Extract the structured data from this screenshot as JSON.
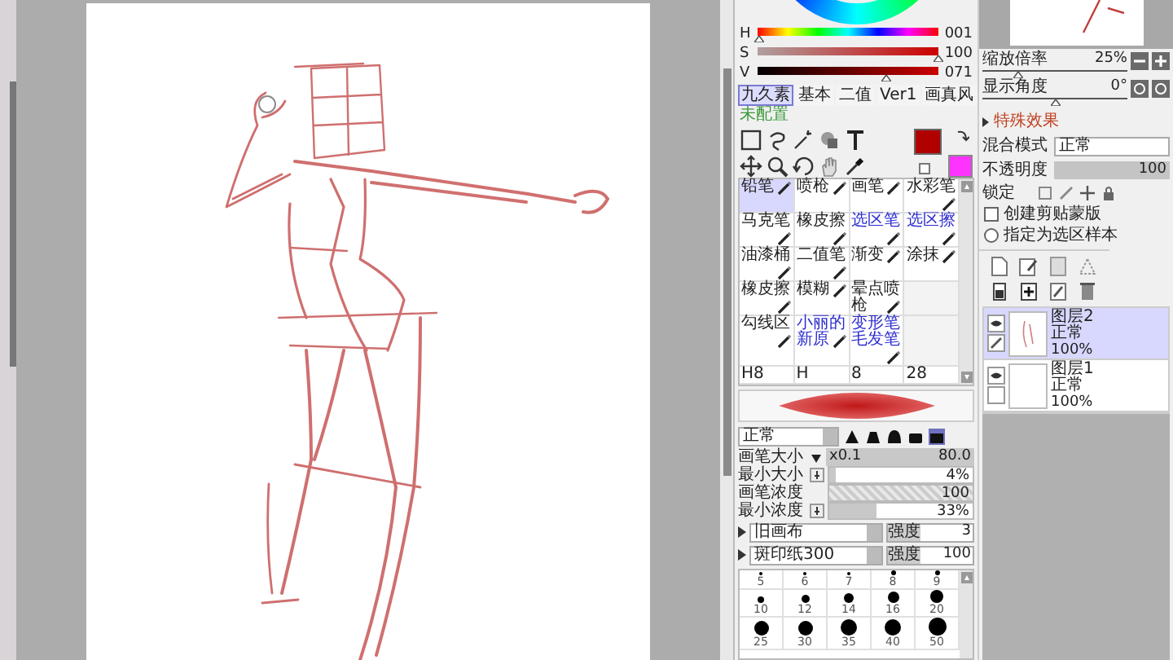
{
  "color_panel": {
    "hsv": [
      {
        "label": "H",
        "value": "001",
        "level": 0.01
      },
      {
        "label": "S",
        "value": "100",
        "level": 1
      },
      {
        "label": "V",
        "value": "071",
        "level": 0.71
      }
    ],
    "swatches": [
      {
        "color": "#b00000"
      },
      {
        "color": "#ff33ff"
      }
    ]
  },
  "brush_sets": [
    {
      "label": "九久素",
      "selected": true
    },
    {
      "label": "基本",
      "selected": false
    },
    {
      "label": "二值",
      "selected": false
    },
    {
      "label": "Ver1",
      "selected": false
    },
    {
      "label": "画真风",
      "selected": false
    }
  ],
  "unassigned_label": "未配置",
  "brush_rows": [
    [
      {
        "label": "铅笔",
        "selected": true,
        "color": "#222222"
      },
      {
        "label": "喷枪",
        "selected": false,
        "color": "#222222"
      },
      {
        "label": "画笔",
        "selected": false,
        "color": "#222222"
      },
      {
        "label": "水彩笔",
        "selected": false,
        "color": "#222222"
      }
    ],
    [
      {
        "label": "马克笔",
        "selected": false,
        "color": "#222222"
      },
      {
        "label": "橡皮擦",
        "selected": false,
        "color": "#222222"
      },
      {
        "label": "选区笔",
        "selected": false,
        "color": "#2b2bd0"
      },
      {
        "label": "选区擦",
        "selected": false,
        "color": "#2b2bd0"
      }
    ],
    [
      {
        "label": "油漆桶",
        "selected": false,
        "color": "#222222"
      },
      {
        "label": "二值笔",
        "selected": false,
        "color": "#222222"
      },
      {
        "label": "渐变",
        "selected": false,
        "color": "#222222"
      },
      {
        "label": "涂抹",
        "selected": false,
        "color": "#222222"
      }
    ],
    [
      {
        "label": "橡皮擦",
        "selected": false,
        "color": "#222222"
      },
      {
        "label": "模糊",
        "selected": false,
        "color": "#222222"
      },
      {
        "label": "晕点喷枪",
        "selected": false,
        "color": "#222222"
      }
    ],
    [
      {
        "label": "勾线区",
        "selected": false,
        "color": "#222222"
      },
      {
        "label": "小丽的新原",
        "selected": false,
        "color": "#2b2bd0"
      },
      {
        "label": "变形笔毛发笔",
        "selected": false,
        "color": "#2b2bd0"
      }
    ],
    [
      {
        "label": "H8",
        "selected": false,
        "color": "#222222"
      },
      {
        "label": "H",
        "selected": false,
        "color": "#222222"
      },
      {
        "label": "8",
        "selected": false,
        "color": "#222222"
      },
      {
        "label": "28",
        "selected": false,
        "color": "#222222"
      }
    ]
  ],
  "blend_mode": "正常",
  "tip_shapes": [
    {
      "selected": false
    },
    {
      "selected": false
    },
    {
      "selected": false
    },
    {
      "selected": false
    },
    {
      "selected": true
    }
  ],
  "brush_params": [
    {
      "kind": "size",
      "label": "画笔大小",
      "prefix": "x0.1",
      "value": "80.0"
    },
    {
      "kind": "pressure",
      "label": "最小大小",
      "value": "4%",
      "level": 0.04
    },
    {
      "kind": "plain",
      "label": "画笔浓度",
      "value": "100",
      "level": 1
    },
    {
      "kind": "pressure",
      "label": "最小浓度",
      "value": "33%",
      "level": 0.33
    }
  ],
  "textures": [
    {
      "name": "旧画布",
      "strength_label": "强度",
      "strength": "3"
    },
    {
      "name": "斑印纸300",
      "strength_label": "强度",
      "strength": "100"
    }
  ],
  "brush_sizes": [
    {
      "label": "5"
    },
    {
      "label": "6"
    },
    {
      "label": "7"
    },
    {
      "label": "8"
    },
    {
      "label": "9"
    },
    {
      "label": "10"
    },
    {
      "label": "12"
    },
    {
      "label": "14"
    },
    {
      "label": "16"
    },
    {
      "label": "20"
    },
    {
      "label": "25"
    },
    {
      "label": "30"
    },
    {
      "label": "35"
    },
    {
      "label": "40"
    },
    {
      "label": "50"
    }
  ],
  "navigator": {
    "zoom": {
      "label": "缩放倍率",
      "value": "25%",
      "level": 0.25
    },
    "angle": {
      "label": "显示角度",
      "value": "0°",
      "level": 0.5
    }
  },
  "effects_label": "特殊效果",
  "blend": {
    "label": "混合模式",
    "value": "正常"
  },
  "opacity": {
    "label": "不透明度",
    "value": "100",
    "level": 1
  },
  "lock_label": "锁定",
  "options": [
    {
      "kind": "checkbox",
      "label": "创建剪贴蒙版",
      "checked": false
    },
    {
      "kind": "radio",
      "label": "指定为选区样本",
      "checked": false
    }
  ],
  "layers": [
    {
      "name": "图层2",
      "mode": "正常",
      "opacity": "100%",
      "selected": true
    },
    {
      "name": "图层1",
      "mode": "正常",
      "opacity": "100%",
      "selected": false
    }
  ]
}
